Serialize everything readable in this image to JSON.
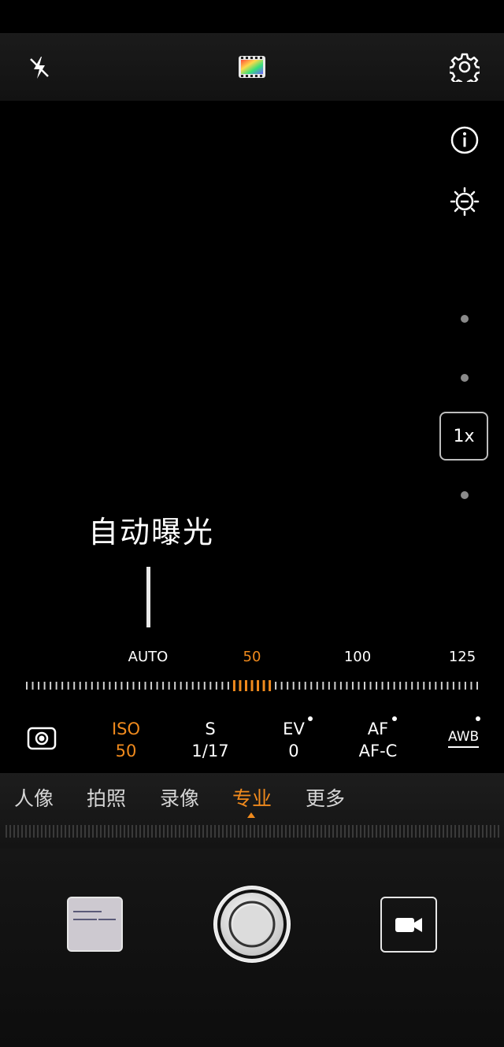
{
  "top_bar": {
    "flash_icon": "flash-off-icon",
    "filter_icon": "color-filter-icon",
    "settings_icon": "gear-icon"
  },
  "side_controls": {
    "info_icon": "info-icon",
    "brightness_icon": "brightness-icon",
    "zoom_label": "1x"
  },
  "viewfinder": {
    "exposure_label": "自动曝光"
  },
  "iso_scale": {
    "labels": [
      "AUTO",
      "50",
      "100",
      "125"
    ],
    "selected": "50"
  },
  "params": [
    {
      "label": "ISO",
      "value": "50",
      "active": true
    },
    {
      "label": "S",
      "value": "1/17"
    },
    {
      "label": "EV",
      "value": "0"
    },
    {
      "label": "AF",
      "value": "AF-C"
    },
    {
      "label": "AWB",
      "value": ""
    }
  ],
  "metering_icon": "metering-icon",
  "modes": {
    "items": [
      "人像",
      "拍照",
      "录像",
      "专业",
      "更多"
    ],
    "active": "专业"
  },
  "bottom": {
    "gallery_icon": "gallery-thumbnail",
    "shutter_icon": "shutter-button",
    "video_icon": "video-camera-icon"
  },
  "colors": {
    "accent": "#f08a1d",
    "background": "#000000"
  }
}
